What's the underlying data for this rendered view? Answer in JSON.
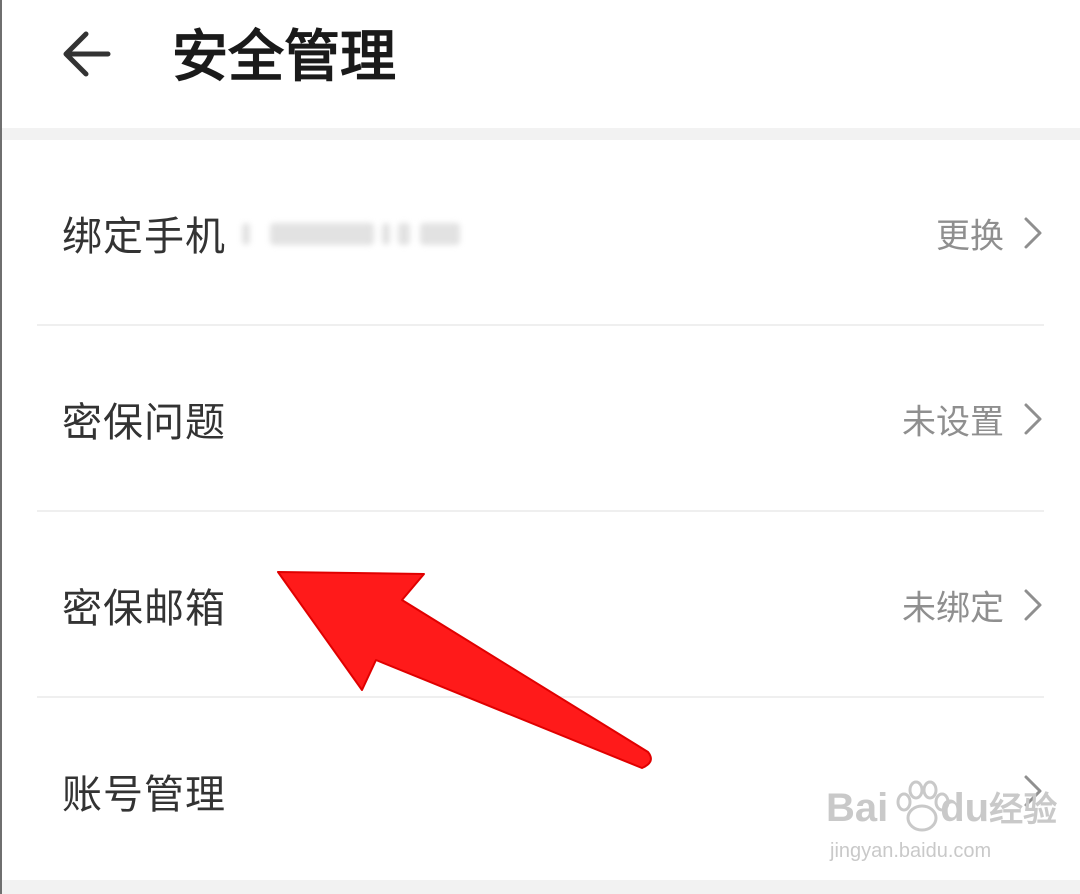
{
  "header": {
    "title": "安全管理",
    "back_icon": "arrow-left-icon"
  },
  "rows": [
    {
      "label": "绑定手机",
      "value": "更换",
      "masked_phone": true
    },
    {
      "label": "密保问题",
      "value": "未设置"
    },
    {
      "label": "密保邮箱",
      "value": "未绑定"
    },
    {
      "label": "账号管理",
      "value": ""
    }
  ],
  "annotation": {
    "color": "#ff1a1a",
    "points_to": "密保邮箱"
  },
  "watermark": {
    "brand_latin": "Bai",
    "brand_suffix": "du",
    "brand_cn": "经验",
    "url": "jingyan.baidu.com"
  },
  "colors": {
    "title": "#1a1a1a",
    "label": "#333333",
    "value": "#8f8f8f",
    "separator": "#f2f2f2"
  }
}
